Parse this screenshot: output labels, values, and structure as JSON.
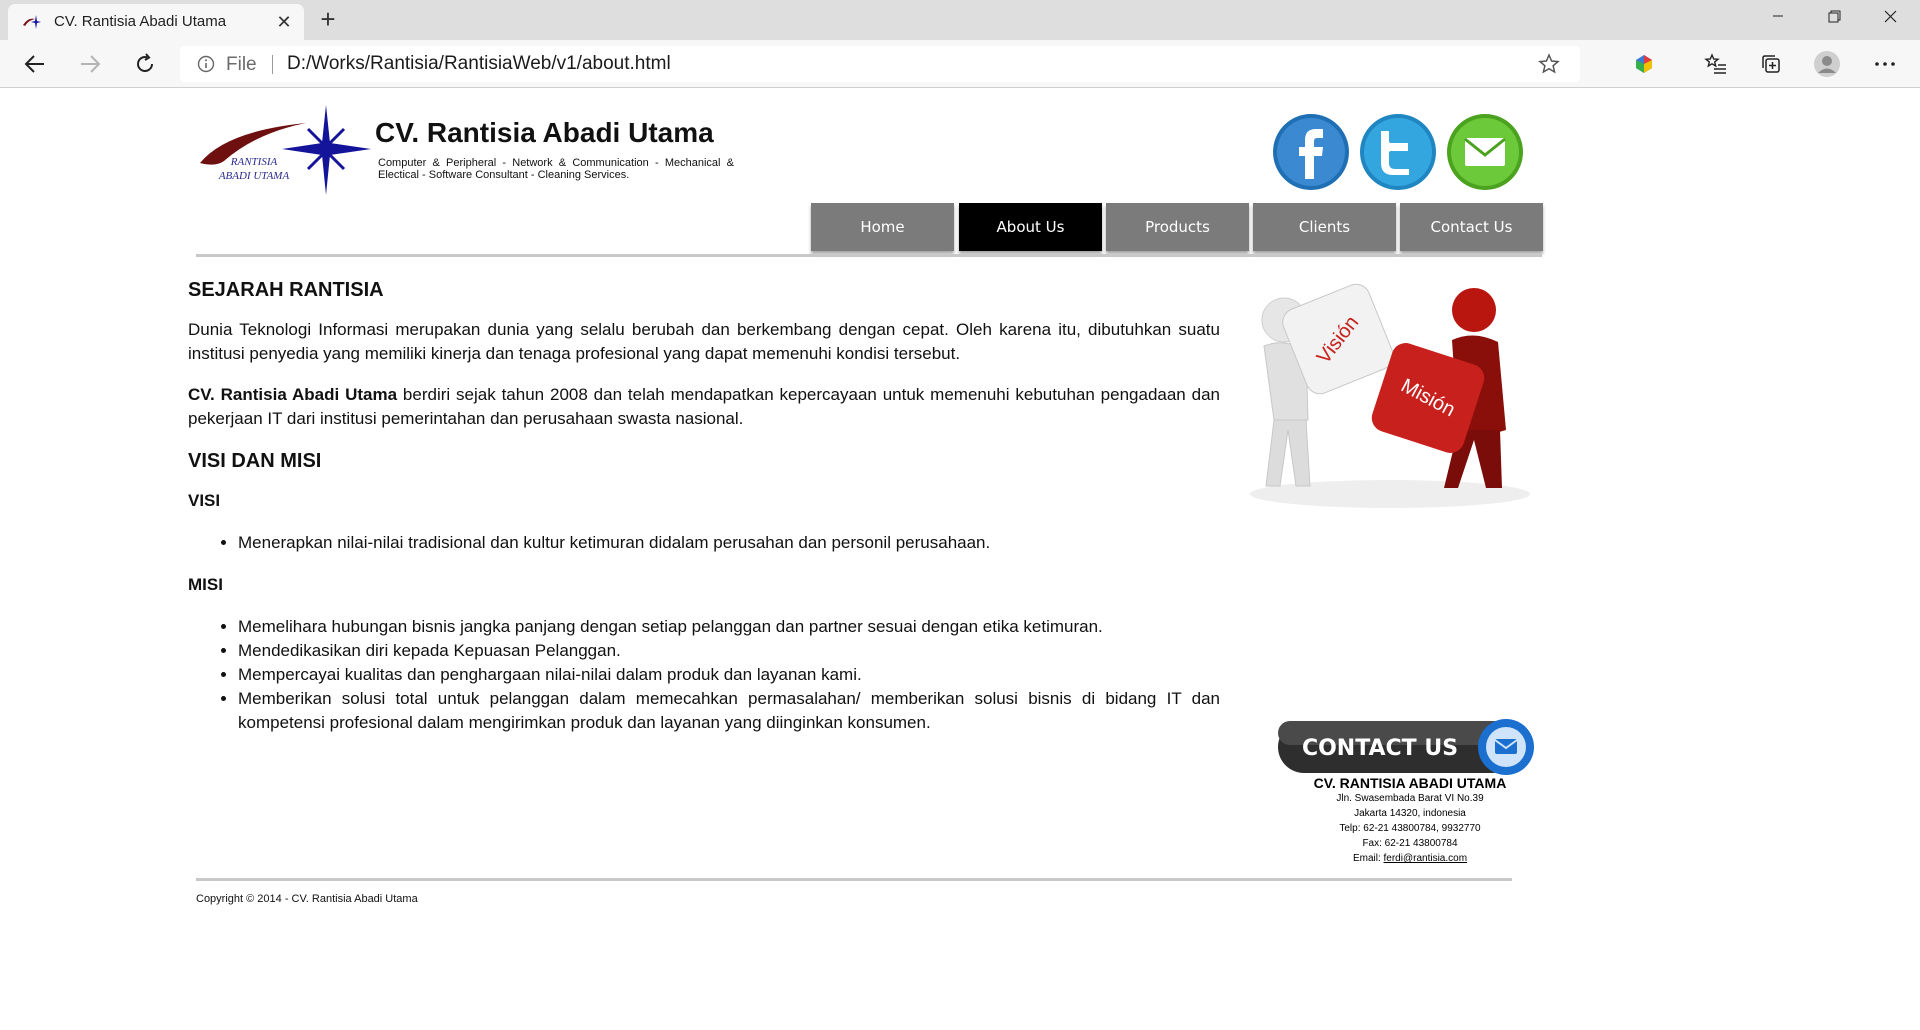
{
  "browser": {
    "tab_title": "CV. Rantisia Abadi Utama",
    "address_prefix": "File",
    "url": "D:/Works/Rantisia/RantisiaWeb/v1/about.html"
  },
  "site": {
    "title": "CV. Rantisia Abadi Utama",
    "tagline": "Computer & Peripheral - Network & Communication - Mechanical & Electical - Software Consultant - Cleaning Services.",
    "logo_text": "RANTISIA ABADI UTAMA"
  },
  "nav": [
    {
      "label": "Home",
      "active": false
    },
    {
      "label": "About Us",
      "active": true
    },
    {
      "label": "Products",
      "active": false
    },
    {
      "label": "Clients",
      "active": false
    },
    {
      "label": "Contact Us",
      "active": false
    }
  ],
  "content": {
    "heading_history": "SEJARAH RANTISIA",
    "para1": "Dunia Teknologi Informasi merupakan dunia yang selalu berubah dan berkembang dengan cepat. Oleh karena itu, dibutuhkan suatu institusi penyedia yang memiliki kinerja dan tenaga profesional yang dapat memenuhi kondisi tersebut.",
    "para2_bold": "CV. Rantisia Abadi Utama",
    "para2_rest": " berdiri sejak tahun 2008 dan telah mendapatkan kepercayaan untuk memenuhi kebutuhan pengadaan dan pekerjaan IT dari institusi pemerintahan dan perusahaan swasta nasional.",
    "heading_visimisi": "VISI DAN MISI",
    "heading_visi": "VISI",
    "visi_items": [
      "Menerapkan nilai-nilai tradisional dan kultur ketimuran didalam perusahan dan personil perusahaan."
    ],
    "heading_misi": "MISI",
    "misi_items": [
      "Memelihara hubungan bisnis jangka panjang dengan setiap pelanggan dan partner sesuai dengan etika ketimuran.",
      "Mendedikasikan diri kepada Kepuasan Pelanggan.",
      "Mempercayai kualitas dan penghargaan nilai-nilai dalam produk dan layanan kami.",
      "Memberikan solusi total untuk pelanggan dalam memecahkan permasalahan/ memberikan solusi bisnis di bidang IT dan kompetensi profesional dalam mengirimkan produk dan layanan yang diinginkan konsumen."
    ]
  },
  "vision_image": {
    "left_text": "Visión",
    "right_text": "Misión"
  },
  "contact": {
    "banner_text": "CONTACT US",
    "company": "CV. RANTISIA ABADI UTAMA",
    "address1": "Jln. Swasembada Barat VI No.39",
    "address2": "Jakarta 14320, indonesia",
    "phone": "Telp: 62-21 43800784, 9932770",
    "fax": "Fax: 62-21 43800784",
    "email_label": "Email: ",
    "email": "ferdi@rantisia.com"
  },
  "footer": {
    "copyright": "Copyright © 2014 - CV. Rantisia Abadi Utama"
  },
  "colors": {
    "nav_inactive": "#7b7b7b",
    "nav_active": "#000000",
    "facebook": "#1f6fb5",
    "twitter": "#2b9fd8",
    "mail": "#5cb82a",
    "vision_red": "#c8201c"
  },
  "icons": [
    "back-icon",
    "forward-icon",
    "reload-icon",
    "info-icon",
    "star-icon",
    "extension-icon",
    "favorites-icon",
    "collections-icon",
    "profile-icon",
    "more-icon",
    "facebook-icon",
    "twitter-icon",
    "mail-icon"
  ]
}
